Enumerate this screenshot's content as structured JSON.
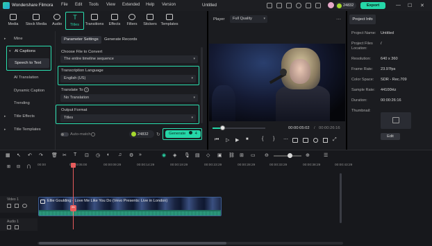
{
  "titlebar": {
    "app_name": "Wondershare Filmora",
    "menu": [
      "File",
      "Edit",
      "Tools",
      "View",
      "Extended",
      "Help",
      "Version"
    ],
    "project_title": "Untitled",
    "credits": "24832",
    "export_label": "Export",
    "window_controls": [
      "—",
      "☐",
      "✕"
    ]
  },
  "media_tabs": [
    {
      "label": "Media",
      "icon": "media-icon"
    },
    {
      "label": "Stock Media",
      "icon": "stock-media-icon"
    },
    {
      "label": "Audio",
      "icon": "audio-icon"
    },
    {
      "label": "Titles",
      "icon": "titles-icon"
    },
    {
      "label": "Transitions",
      "icon": "transitions-icon"
    },
    {
      "label": "Effects",
      "icon": "effects-icon"
    },
    {
      "label": "Filters",
      "icon": "filters-icon"
    },
    {
      "label": "Stickers",
      "icon": "stickers-icon"
    },
    {
      "label": "Templates",
      "icon": "templates-icon"
    }
  ],
  "sidebar": {
    "items": [
      {
        "label": "Mine",
        "caret": "▸"
      },
      {
        "label": "AI Captions",
        "caret": "▾"
      },
      {
        "label": "Speech to Text"
      },
      {
        "label": "AI Translation"
      },
      {
        "label": "Dynamic Caption"
      },
      {
        "label": "Trending"
      },
      {
        "label": "Title Effects",
        "caret": "▸"
      },
      {
        "label": "Title Templates",
        "caret": "▸"
      }
    ]
  },
  "content": {
    "tabs": [
      "Parameter Settings",
      "Generate Records"
    ],
    "file_to_convert_label": "Choose File to Convert",
    "file_to_convert_value": "The entire timeline sequence",
    "language_label": "Transcription Language",
    "language_value": "English (US)",
    "translate_label": "Translate To",
    "translate_value": "No Translation",
    "output_label": "Output Format",
    "output_value": "Titles",
    "auto_match_label": "Auto-match",
    "credits": "24832",
    "generate_label": "Generate",
    "generate_cost": "4"
  },
  "player": {
    "label": "Player",
    "quality": "Full Quality",
    "current_time": "00:00:05:02",
    "separator": "/",
    "total_time": "00:00:26:16",
    "progress": 0.19,
    "controls": [
      "⏮",
      "▷",
      "▶",
      "■",
      "{",
      "}",
      "⋯"
    ]
  },
  "project_info": {
    "tab": "Project Info",
    "fields": [
      {
        "key": "Project Name:",
        "value": "Untitled"
      },
      {
        "key": "Project Files Location:",
        "value": "/"
      },
      {
        "key": "Resolution:",
        "value": "640 x 360"
      },
      {
        "key": "Frame Rate:",
        "value": "23.97fps"
      },
      {
        "key": "Color Space:",
        "value": "SDR - Rec.709"
      },
      {
        "key": "Sample Rate:",
        "value": "44100Hz"
      },
      {
        "key": "Duration:",
        "value": "00:00:26:16"
      }
    ],
    "thumbnail_label": "Thumbnail:",
    "edit_label": "Edit"
  },
  "timeline": {
    "ticks": [
      "00:00",
      "00:00:05:00",
      "00:00:09:29",
      "00:00:14:29",
      "00:00:19:29",
      "00:00:23:29",
      "00:00:28:29",
      "00:00:33:29",
      "00:00:38:29",
      "00:00:43:29"
    ],
    "tracks": [
      {
        "label": "Video 1"
      },
      {
        "label": "Audio 1"
      }
    ],
    "clip_title": "Ellie Goulding - Love Me Like You Do (Vevo Presents: Live in London)"
  }
}
